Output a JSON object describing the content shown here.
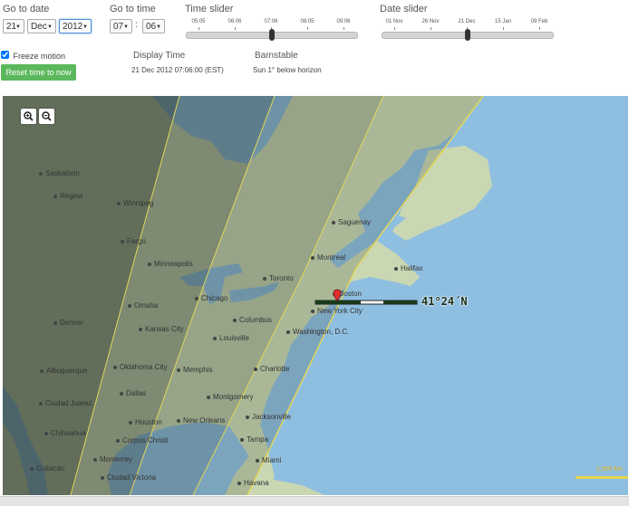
{
  "controls": {
    "go_to_date_label": "Go to date",
    "day": "21",
    "month": "Dec",
    "year": "2012",
    "go_to_time_label": "Go to time",
    "hour": "07",
    "time_sep": ":",
    "minute": "06",
    "time_slider_label": "Time slider",
    "time_ticks": [
      "05:05",
      "06:06",
      "07:06",
      "08:05",
      "09:06"
    ],
    "time_slider_position": 0.5,
    "date_slider_label": "Date slider",
    "date_ticks": [
      "01 Nov",
      "26 Nov",
      "21 Dec",
      "15 Jan",
      "09 Feb"
    ],
    "date_slider_position": 0.5,
    "freeze_label": "Freeze motion",
    "freeze_checked": true,
    "reset_label": "Reset time to now"
  },
  "info": {
    "display_time_label": "Display Time",
    "display_time_value": "21 Dec 2012 07:06:00 (EST)",
    "location_name": "Barnstable",
    "sun_status": "Sun 1° below horizon"
  },
  "map": {
    "latitude_label": "41°24´N",
    "scale_label": "1,000 km",
    "cities": [
      {
        "name": "Saskatoon"
      },
      {
        "name": "Regina"
      },
      {
        "name": "Winnipeg"
      },
      {
        "name": "Fargo"
      },
      {
        "name": "Minneapolis"
      },
      {
        "name": "Omaha"
      },
      {
        "name": "Denver"
      },
      {
        "name": "Kansas City"
      },
      {
        "name": "Chicago"
      },
      {
        "name": "Toronto"
      },
      {
        "name": "Montreal"
      },
      {
        "name": "Saguenay"
      },
      {
        "name": "Halifax"
      },
      {
        "name": "Boston"
      },
      {
        "name": "New York City"
      },
      {
        "name": "Washington, D.C."
      },
      {
        "name": "Columbus"
      },
      {
        "name": "Louisville"
      },
      {
        "name": "Memphis"
      },
      {
        "name": "Oklahoma City"
      },
      {
        "name": "Albuquerque"
      },
      {
        "name": "Dallas"
      },
      {
        "name": "Charlotte"
      },
      {
        "name": "Montgomery"
      },
      {
        "name": "Ciudad Juarez"
      },
      {
        "name": "Chihuahua"
      },
      {
        "name": "Houston"
      },
      {
        "name": "New Orleans"
      },
      {
        "name": "Jacksonville"
      },
      {
        "name": "Corpus Christi"
      },
      {
        "name": "Tampa"
      },
      {
        "name": "Miami"
      },
      {
        "name": "Culiacán"
      },
      {
        "name": "Monterrey"
      },
      {
        "name": "Ciudad Victoria"
      },
      {
        "name": "Havana"
      }
    ]
  }
}
